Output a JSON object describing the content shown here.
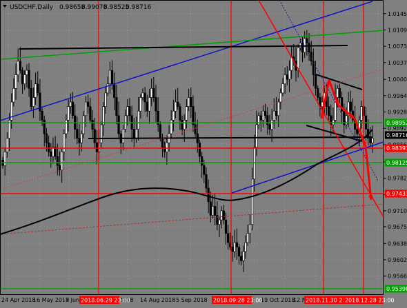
{
  "chart_data": {
    "type": "candlestick",
    "title": "USDCHF,Daily",
    "ohlc": [
      "0.98658",
      "0.99078",
      "0.98525",
      "0.98716"
    ],
    "ylim": [
      0.9526,
      1.0172
    ],
    "y_ticks": [
      "1.01450",
      "1.01090",
      "1.00730",
      "1.00370",
      "1.00000",
      "0.99640",
      "0.99280",
      "0.98920",
      "0.98560",
      "0.98180",
      "0.97820",
      "0.97460",
      "0.97100",
      "0.96750",
      "0.96380",
      "0.96020",
      "0.95660"
    ],
    "x_labels": [
      "24 Apr 2018",
      "16 May 2018",
      "7 Jun 2018",
      "23 Jul 2018",
      "14 Aug 2018",
      "5 Sep 2018",
      "19 Oct 2018",
      "12 N"
    ],
    "highlighted_x_labels": [
      "2018.06.29 23:00",
      "2018.09.28 23:00",
      "2018.11.30 23:00",
      "2018.12.28 23:00"
    ],
    "level_labels": [
      {
        "text": "0.98952",
        "color": "#00a000"
      },
      {
        "text": "0.98716",
        "color": "#000000"
      },
      {
        "text": "0.98393",
        "color": "#ff0000"
      },
      {
        "text": "0.98125",
        "color": "#00a000"
      },
      {
        "text": "0.97433",
        "color": "#ff0000"
      },
      {
        "text": "0.95398",
        "color": "#00a000"
      }
    ],
    "close_series": [
      0.981,
      0.984,
      0.987,
      0.991,
      0.995,
      0.998,
      1.001,
      1.004,
      1.002,
      0.999,
      1.001,
      1.002,
      0.998,
      0.994,
      0.996,
      0.999,
      0.997,
      0.993,
      0.991,
      0.988,
      0.986,
      0.984,
      0.983,
      0.985,
      0.983,
      0.981,
      0.98,
      0.984,
      0.988,
      0.991,
      0.994,
      0.995,
      0.992,
      0.989,
      0.987,
      0.986,
      0.988,
      0.992,
      0.995,
      0.994,
      0.991,
      0.989,
      0.986,
      0.984,
      0.986,
      0.99,
      0.994,
      0.997,
      0.999,
      1.002,
      0.999,
      0.996,
      0.992,
      0.988,
      0.986,
      0.989,
      0.992,
      0.994,
      0.992,
      0.989,
      0.987,
      0.989,
      0.993,
      0.996,
      0.997,
      0.995,
      0.993,
      0.996,
      0.998,
      0.996,
      0.993,
      0.99,
      0.987,
      0.985,
      0.984,
      0.986,
      0.988,
      0.991,
      0.993,
      0.995,
      0.994,
      0.991,
      0.989,
      0.991,
      0.994,
      0.996,
      0.994,
      0.99,
      0.988,
      0.986,
      0.983,
      0.981,
      0.979,
      0.976,
      0.973,
      0.97,
      0.972,
      0.97,
      0.968,
      0.969,
      0.971,
      0.969,
      0.966,
      0.964,
      0.963,
      0.962,
      0.964,
      0.963,
      0.961,
      0.96,
      0.962,
      0.964,
      0.966,
      0.968,
      0.978,
      0.985,
      0.99,
      0.992,
      0.991,
      0.993,
      0.992,
      0.99,
      0.989,
      0.991,
      0.993,
      0.992,
      0.995,
      0.997,
      0.999,
      1.001,
      1.0,
      1.002,
      1.005,
      1.004,
      1.002,
      1.007,
      1.008,
      1.006,
      1.009,
      1.008,
      1.006,
      1.004,
      1.001,
      0.998,
      0.996,
      0.994,
      0.995,
      0.997,
      0.994,
      0.992,
      0.99,
      0.991,
      0.996,
      0.998,
      0.996,
      0.993,
      0.99,
      0.992,
      0.995,
      0.993,
      0.991,
      0.989,
      0.988,
      0.991,
      0.994,
      0.992,
      0.989,
      0.987,
      0.986,
      0.987
    ]
  }
}
